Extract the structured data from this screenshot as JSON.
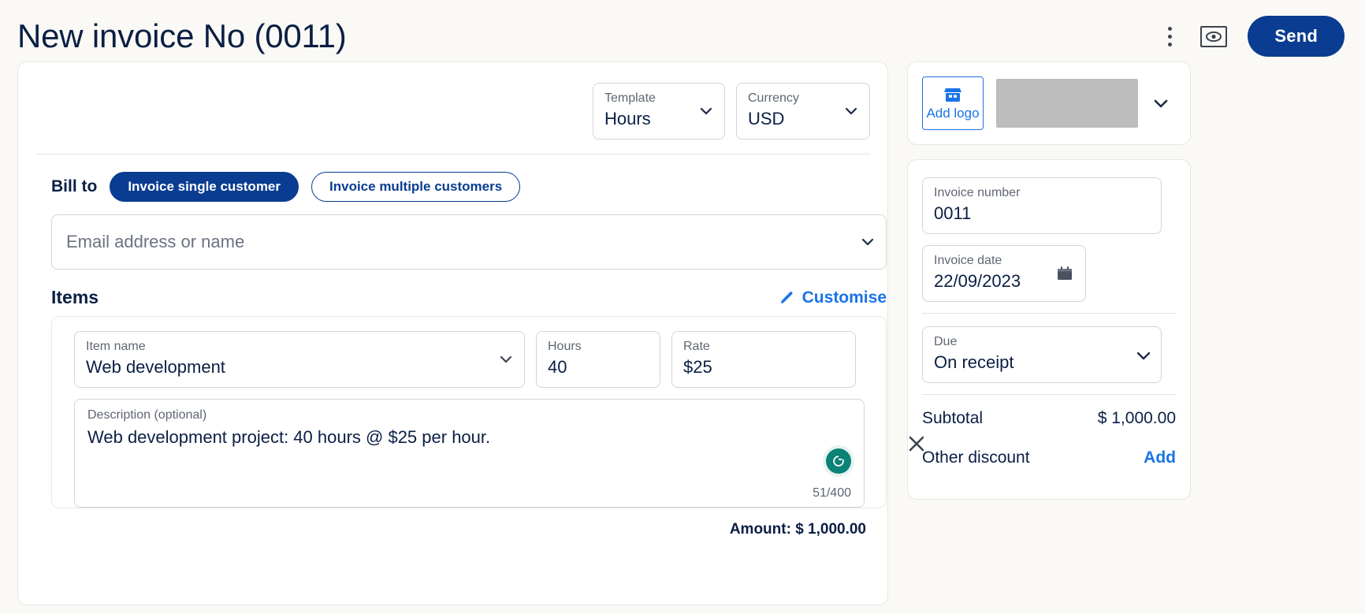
{
  "header": {
    "title": "New invoice No (0011)",
    "menu_icon": "kebab-menu-icon",
    "preview_icon": "preview-eye-icon",
    "send_label": "Send"
  },
  "top_selects": {
    "template": {
      "label": "Template",
      "value": "Hours"
    },
    "currency": {
      "label": "Currency",
      "value": "USD"
    }
  },
  "bill_to": {
    "label": "Bill to",
    "single_label": "Invoice single customer",
    "multiple_label": "Invoice multiple customers",
    "email_placeholder": "Email address or name",
    "email_value": ""
  },
  "items": {
    "title": "Items",
    "customise_label": "Customise",
    "item_name": {
      "label": "Item name",
      "value": "Web development"
    },
    "hours": {
      "label": "Hours",
      "value": "40"
    },
    "rate": {
      "label": "Rate",
      "value": "$25"
    },
    "description": {
      "label": "Description (optional)",
      "value": "Web development project: 40 hours @ $25 per hour.",
      "counter": "51/400"
    },
    "amount_label": "Amount: $ 1,000.00"
  },
  "logo_panel": {
    "add_logo_label": "Add logo"
  },
  "details": {
    "invoice_number": {
      "label": "Invoice number",
      "value": "0011"
    },
    "invoice_date": {
      "label": "Invoice date",
      "value": "22/09/2023"
    },
    "due": {
      "label": "Due",
      "value": "On receipt"
    }
  },
  "totals": {
    "subtotal_label": "Subtotal",
    "subtotal_value": "$ 1,000.00",
    "discount_label": "Other discount",
    "discount_action": "Add"
  },
  "colors": {
    "brand_blue": "#0a3d91",
    "link_blue": "#1a73e8",
    "navy": "#0b1f44",
    "page_bg": "#faf9f5",
    "grammarly_green": "#0b8276"
  }
}
